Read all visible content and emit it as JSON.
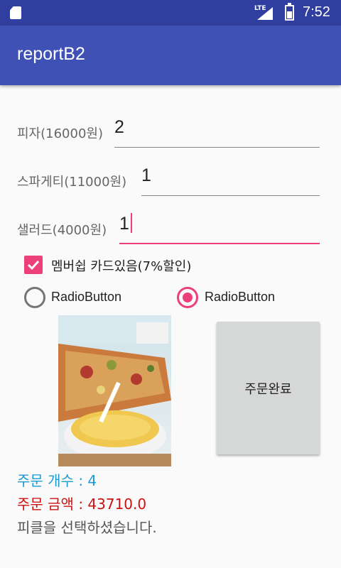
{
  "status_bar": {
    "network_label": "LTE",
    "time": "7:52",
    "battery_level": 0.55
  },
  "app_bar": {
    "title": "reportB2"
  },
  "form": {
    "pizza": {
      "label": "피자(16000원)",
      "value": "2"
    },
    "spaghetti": {
      "label": "스파게티(11000원)",
      "value": "1"
    },
    "salad": {
      "label": "샐러드(4000원)",
      "value": "1"
    }
  },
  "membership_checkbox": {
    "label": "멤버쉽 카드있음(7%할인)",
    "checked": true
  },
  "radio_options": [
    {
      "label": "RadioButton",
      "checked": false
    },
    {
      "label": "RadioButton",
      "checked": true
    }
  ],
  "order_button": {
    "label": "주문완료"
  },
  "results": {
    "count_text": "주문 개수 : 4",
    "amount_text": "주문 금액 : 43710.0",
    "message_text": "피클을 선택하셨습니다."
  },
  "colors": {
    "primary": "#3f51b5",
    "primary_dark": "#303f9f",
    "accent": "#ec407a",
    "count_color": "#1b9bd1",
    "amount_color": "#cc1111"
  },
  "icons": [
    "sd-card-icon",
    "signal-icon",
    "battery-icon",
    "checkmark-icon"
  ]
}
